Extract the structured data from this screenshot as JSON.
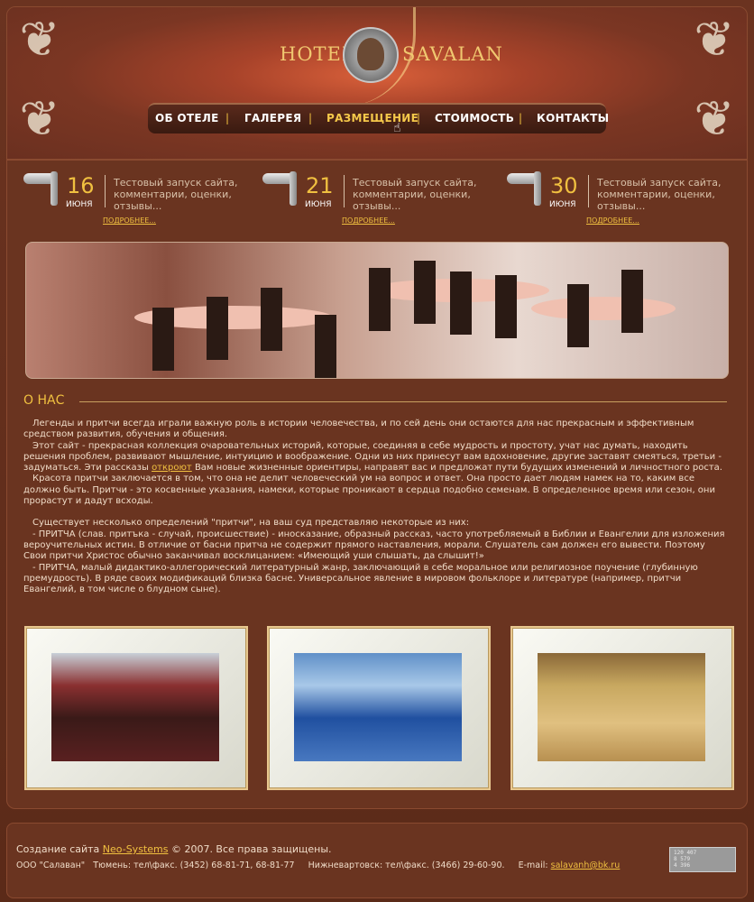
{
  "header": {
    "logo_left": "HOTEL",
    "logo_right": "SAVALAN"
  },
  "nav": {
    "items": [
      {
        "label": "ОБ ОТЕЛЕ",
        "active": false
      },
      {
        "label": "ГАЛЕРЕЯ",
        "active": false
      },
      {
        "label": "РАЗМЕЩЕНИЕ",
        "active": true
      },
      {
        "label": "СТОИМОСТЬ",
        "active": false
      },
      {
        "label": "КОНТАКТЫ",
        "active": false
      }
    ],
    "separator": "|"
  },
  "news": [
    {
      "day": "16",
      "month": "ИЮНЯ",
      "text": "Тестовый запуск сайта, комментарии, оценки, отзывы...",
      "more": "ПОДРОБНЕЕ..."
    },
    {
      "day": "21",
      "month": "ИЮНЯ",
      "text": "Тестовый запуск сайта, комментарии, оценки, отзывы...",
      "more": "ПОДРОБНЕЕ..."
    },
    {
      "day": "30",
      "month": "ИЮНЯ",
      "text": "Тестовый запуск сайта, комментарии, оценки, отзывы...",
      "more": "ПОДРОБНЕЕ..."
    }
  ],
  "about": {
    "title": "О НАС",
    "p1": "Легенды и притчи всегда играли важную роль в истории человечества, и по сей день они остаются для нас прекрасным и эффективным средством развития, обучения и общения.",
    "p2_before": "Этот сайт - прекрасная коллекция очаровательных историй, которые, соединяя в себе мудрость и простоту, учат нас думать, находить решения проблем, развивают мышление, интуицию и воображение. Одни из них принесут вам вдохновение, другие заставят смеяться, третьи - задуматься. Эти рассказы ",
    "p2_link": "откроют",
    "p2_after": " Вам новые жизненные ориентиры, направят вас и предложат пути будущих изменений и личностного роста.",
    "p3": "Красота притчи заключается в том, что она не делит человеческий ум на вопрос и ответ. Она просто дает людям намек на то, каким все должно быть. Притчи - это косвенные указания, намеки, которые проникают в сердца подобно семенам. В определенное время или сезон, они прорастут и дадут всходы.",
    "p4": "Существует несколько определений \"притчи\", на ваш суд представляю некоторые из них:",
    "p5": "- ПРИТЧА (слав. притъка - случай, происшествие) - иносказание, образный рассказ, часто употребляемый в Библии и Евангелии для изложения вероучительных истин. В отличие от басни притча не содержит прямого наставления, морали. Слушатель сам должен его вывести. Поэтому Свои притчи Христос обычно заканчивал восклицанием: «Имеющий уши слышать, да слышит!»",
    "p6": "- ПРИТЧА, малый дидактико-аллегорический литературный жанр, заключающий в себе моральное или религиозное поучение (глубинную премудрость). В ряде своих модификаций близка басне. Универсальное явление в мировом фольклоре и литературе (например, притчи Евангелий, в том числе о блудном сыне)."
  },
  "footer": {
    "copy_before": "Создание сайта ",
    "copy_link": "Neo-Systems",
    "copy_after": " © 2007. Все права защищены.",
    "contacts": "ООО \"Салаван\"   Тюмень: тел\\факс. (3452) 68-81-71, 68-81-77     Нижневартовск: тел\\факс. (3466) 29-60-90.     E-mail: ",
    "email": "salavanh@bk.ru",
    "counter_lines": [
      "120 407",
      "8 579",
      "4 396"
    ]
  }
}
